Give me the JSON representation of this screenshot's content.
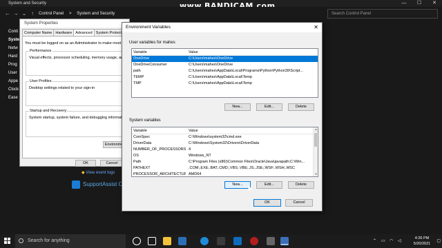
{
  "watermark": "www.BANDICAM.com",
  "control_panel": {
    "title": "System and Security",
    "breadcrumb": [
      "Control Panel",
      ">",
      "System and Security"
    ],
    "search_placeholder": "Search Control Panel",
    "left_items": [
      "Conti",
      "Syste",
      "Netw",
      "Hard",
      "Prog",
      "User",
      "Appe",
      "Clock",
      "Ease"
    ],
    "view_event_logs": "View event logs",
    "support_assist": "SupportAssist O"
  },
  "system_properties": {
    "title": "System Properties",
    "tabs": [
      "Computer Name",
      "Hardware",
      "Advanced",
      "System Protection"
    ],
    "active_tab": "Advanced",
    "note": "You must be logged on as an Administrator to make most of th",
    "performance_label": "Performance",
    "performance_text": "Visual effects, processor scheduling, memory usage, and virt",
    "profiles_label": "User Profiles",
    "profiles_text": "Desktop settings related to your sign-in",
    "startup_label": "Startup and Recovery",
    "startup_text": "System startup, system failure, and debugging information",
    "env_button": "Environment",
    "ok": "OK",
    "cancel": "Cancel"
  },
  "env_dialog": {
    "title": "Environment Variables",
    "user_section": "User variables for mahes",
    "system_section": "System variables",
    "col_variable": "Variable",
    "col_value": "Value",
    "user_vars": [
      {
        "name": "OneDrive",
        "value": "C:\\Users\\mahes\\OneDrive",
        "selected": true
      },
      {
        "name": "OneDriveConsumer",
        "value": "C:\\Users\\mahes\\OneDrive"
      },
      {
        "name": "path",
        "value": "C:\\Users\\mahes\\AppData\\Local\\Programs\\Python\\Python39\\Script..."
      },
      {
        "name": "TEMP",
        "value": "C:\\Users\\mahes\\AppData\\Local\\Temp"
      },
      {
        "name": "TMP",
        "value": "C:\\Users\\mahes\\AppData\\Local\\Temp"
      }
    ],
    "system_vars": [
      {
        "name": "ComSpec",
        "value": "C:\\Windows\\system32\\cmd.exe"
      },
      {
        "name": "DriverData",
        "value": "C:\\Windows\\System32\\Drivers\\DriverData"
      },
      {
        "name": "NUMBER_OF_PROCESSORS",
        "value": "4"
      },
      {
        "name": "OS",
        "value": "Windows_NT"
      },
      {
        "name": "Path",
        "value": "C:\\Program Files (x86)\\Common Files\\Oracle\\Java\\javapath;C:\\Win..."
      },
      {
        "name": "PATHEXT",
        "value": ".COM;.EXE;.BAT;.CMD;.VBS;.VBE;.JS;.JSE;.WSF;.WSH;.MSC"
      },
      {
        "name": "PROCESSOR_ARCHITECTURE",
        "value": "AMD64"
      }
    ],
    "user_buttons": {
      "new": "New...",
      "edit": "Edit...",
      "delete": "Delete"
    },
    "system_buttons": {
      "new": "New...",
      "edit": "Edit...",
      "delete": "Delete"
    },
    "ok": "OK",
    "cancel": "Cancel"
  },
  "taskbar": {
    "search_text": "Search for anything",
    "time": "4:26 PM",
    "date": "5/20/2021"
  }
}
